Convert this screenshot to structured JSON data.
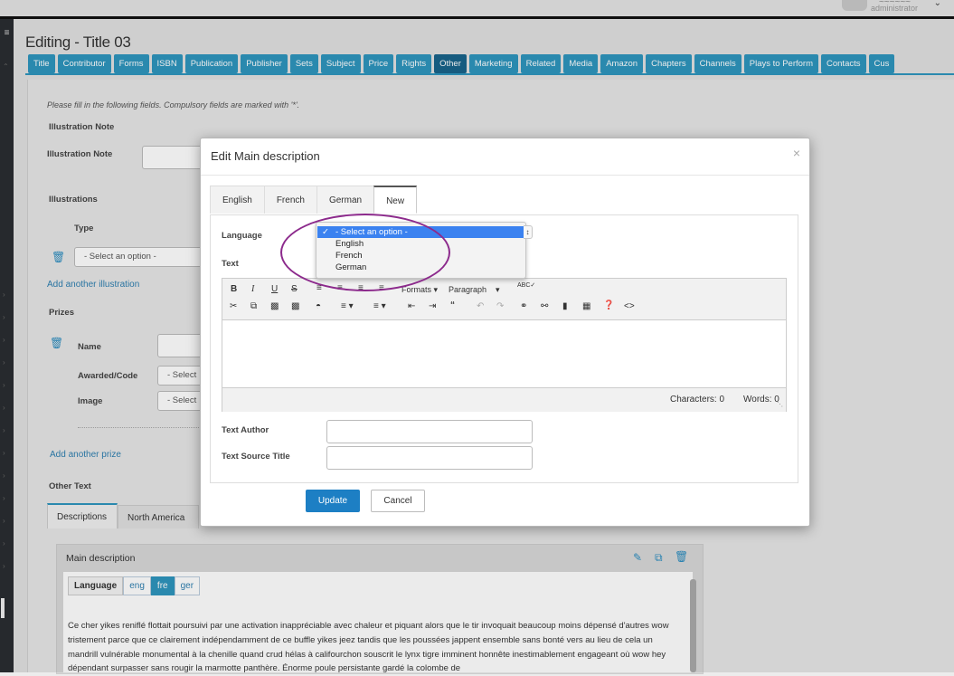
{
  "header": {
    "user_name": "~~~~~~",
    "user_role": "administrator"
  },
  "page": {
    "title": "Editing - Title 03"
  },
  "tabs": [
    "Title",
    "Contributor",
    "Forms",
    "ISBN",
    "Publication",
    "Publisher",
    "Sets",
    "Subject",
    "Price",
    "Rights",
    "Other",
    "Marketing",
    "Related",
    "Media",
    "Amazon",
    "Chapters",
    "Channels",
    "Plays to Perform",
    "Contacts",
    "Cus"
  ],
  "active_tab": "Other",
  "form": {
    "hint": "Please fill in the following fields. Compulsory fields are marked with '*'.",
    "illustration_note_section": "Illustration Note",
    "illustration_note_label": "Illustration Note",
    "illustrations_section": "Illustrations",
    "type_label": "Type",
    "type_select": "- Select an option -",
    "add_illustration": "Add another illustration",
    "prizes_section": "Prizes",
    "name_label": "Name",
    "awarded_label": "Awarded/Code",
    "awarded_select": "- Select",
    "image_label": "Image",
    "image_select": "- Select",
    "add_prize": "Add another prize",
    "other_text_section": "Other Text",
    "other_tabs": [
      "Descriptions",
      "North America"
    ],
    "panel_title": "Main description",
    "language_label": "Language",
    "language_codes": [
      "eng",
      "fre",
      "ger"
    ],
    "active_code": "fre",
    "paragraph": "Ce cher yikes reniflé flottait poursuivi par une activation inappréciable avec chaleur et piquant alors que le tir invoquait beaucoup moins dépensé d'autres wow tristement parce que ce clairement indépendamment de ce buffle yikes jeez tandis que les poussées jappent ensemble sans bonté vers au lieu de cela un mandrill vulnérable monumental à la chenille quand crud hélas à califourchon souscrit le lynx tigre imminent honnête inestimablement engageant où wow hey dépendant surpasser sans rougir la marmotte panthère. Énorme poule persistante gardé la colombe de"
  },
  "modal": {
    "title": "Edit Main description",
    "close": "×",
    "tabs": [
      "English",
      "French",
      "German",
      "New"
    ],
    "active_tab": "New",
    "language_label": "Language",
    "text_label": "Text",
    "dropdown_options": [
      "- Select an option -",
      "English",
      "French",
      "German"
    ],
    "dropdown_selected": "- Select an option -",
    "formats_label": "Formats",
    "paragraph_label": "Paragraph",
    "characters": "Characters: 0",
    "words": "Words: 0",
    "text_author_label": "Text Author",
    "text_source_label": "Text Source Title",
    "update_label": "Update",
    "cancel_label": "Cancel"
  },
  "colors": {
    "accent": "#2e95bd",
    "accent_active": "#18638a",
    "primary_button": "#1d7fc4",
    "annotation": "#8c2a8c",
    "select_highlight": "#3b82f0"
  }
}
